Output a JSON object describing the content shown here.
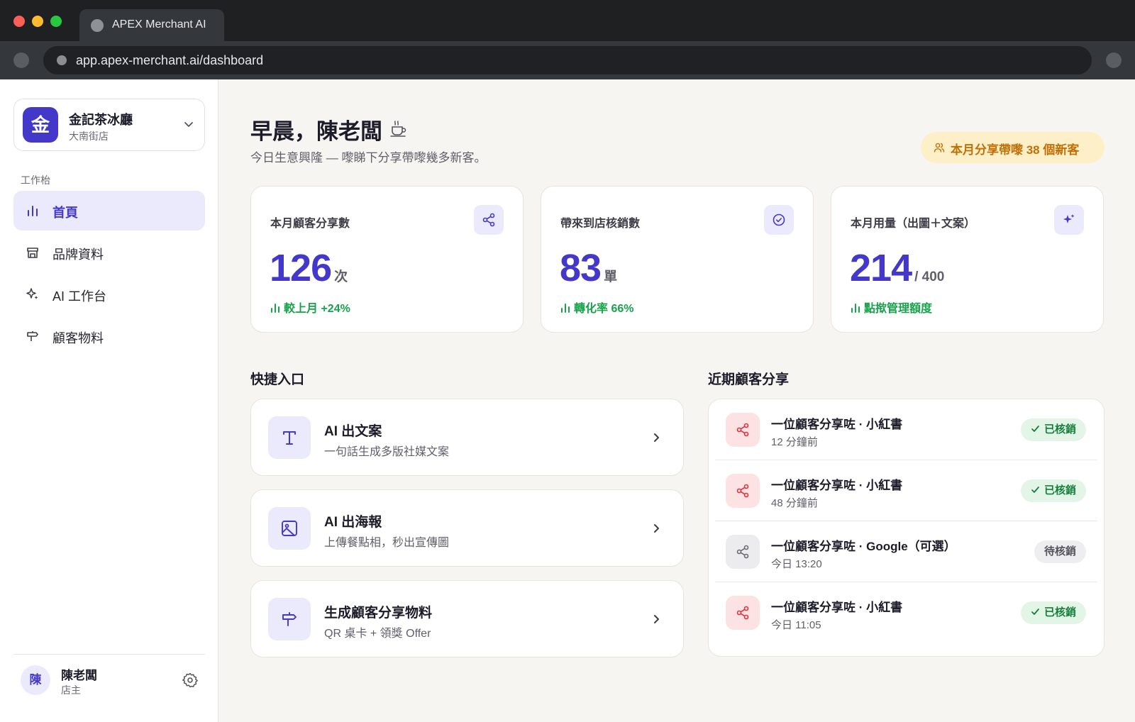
{
  "browser": {
    "tab_title": "APEX Merchant AI",
    "url": "app.apex-merchant.ai/dashboard"
  },
  "sidebar": {
    "store": {
      "logo_char": "金",
      "name": "金記茶冰廳",
      "branch": "大南街店"
    },
    "section_label": "工作枱",
    "items": [
      {
        "label": "首頁",
        "icon": "bar-chart-icon",
        "active": true
      },
      {
        "label": "品牌資料",
        "icon": "store-icon",
        "active": false
      },
      {
        "label": "AI 工作台",
        "icon": "sparkles-icon",
        "active": false
      },
      {
        "label": "顧客物料",
        "icon": "signpost-icon",
        "active": false
      }
    ],
    "user": {
      "avatar_char": "陳",
      "name": "陳老闆",
      "role": "店主"
    }
  },
  "header": {
    "greeting": "早晨，陳老闆",
    "subtitle": "今日生意興隆 — 嚟睇下分享帶嚟幾多新客。",
    "pill": "本月分享帶嚟 38 個新客"
  },
  "stats": [
    {
      "label": "本月顧客分享數",
      "value": "126",
      "unit": "次",
      "note": "較上月 +24%",
      "icon": "share-icon"
    },
    {
      "label": "帶來到店核銷數",
      "value": "83",
      "unit": "單",
      "note": "轉化率 66%",
      "icon": "check-circle-icon"
    },
    {
      "label": "本月用量（出圖＋文案）",
      "value": "214",
      "unit": "/ 400",
      "note": "點揿管理額度",
      "icon": "sparkles-icon"
    }
  ],
  "quick": {
    "title": "快捷入口",
    "items": [
      {
        "title": "AI 出文案",
        "sub": "一句話生成多版社媒文案",
        "icon": "text-icon"
      },
      {
        "title": "AI 出海報",
        "sub": "上傳餐點相，秒出宣傳圖",
        "icon": "image-icon"
      },
      {
        "title": "生成顧客分享物料",
        "sub": "QR 桌卡 + 領獎 Offer",
        "icon": "signpost-icon"
      }
    ]
  },
  "shares": {
    "title": "近期顧客分享",
    "items": [
      {
        "title": "一位顧客分享咗 · 小紅書",
        "time": "12 分鐘前",
        "status": "已核銷",
        "state": "done"
      },
      {
        "title": "一位顧客分享咗 · 小紅書",
        "time": "48 分鐘前",
        "status": "已核銷",
        "state": "done"
      },
      {
        "title": "一位顧客分享咗 · Google（可選）",
        "time": "今日 13:20",
        "status": "待核銷",
        "state": "pending"
      },
      {
        "title": "一位顧客分享咗 · 小紅書",
        "time": "今日 11:05",
        "status": "已核銷",
        "state": "done"
      }
    ]
  },
  "colors": {
    "accent": "#4338ca",
    "accent_soft": "#ebe9fc",
    "success": "#16a34a",
    "warning": "#c46f06",
    "share_red": "#e0303b"
  }
}
